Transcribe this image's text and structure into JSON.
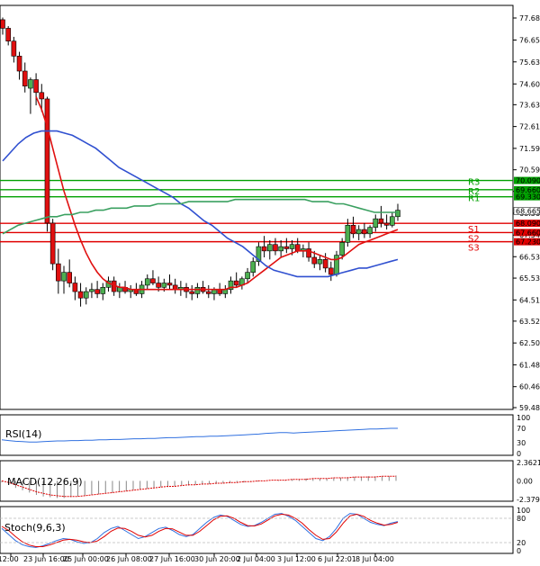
{
  "chart_data": [
    {
      "type": "candlestick",
      "price_axis": {
        "ticks": [
          "77.680",
          "76.650",
          "75.630",
          "74.600",
          "73.630",
          "72.610",
          "71.590",
          "70.590",
          "69.580",
          "68.560",
          "67.540",
          "66.530",
          "65.530",
          "64.510",
          "63.520",
          "62.500",
          "61.480",
          "60.460",
          "59.480"
        ],
        "tick_values": [
          77.68,
          76.65,
          75.63,
          74.6,
          73.63,
          72.61,
          71.59,
          70.59,
          69.58,
          68.56,
          67.54,
          66.53,
          65.53,
          64.51,
          63.52,
          62.5,
          61.48,
          60.46,
          59.48
        ],
        "ylim": [
          59.48,
          77.68
        ]
      },
      "time_axis": {
        "ticks": [
          "n 12:00",
          "23 Jun 16:00",
          "25 Jun 00:00",
          "26 Jun 08:00",
          "27 Jun 16:00",
          "30 Jun 20:00",
          "2 Jul 04:00",
          "3 Jul 12:00",
          "6 Jul 22:01",
          "8 Jul 04:00"
        ]
      },
      "current_price": "68.665",
      "levels": [
        {
          "label": "R3",
          "value": "70.090",
          "color": "#00a000"
        },
        {
          "label": "R2",
          "value": "69.660",
          "color": "#00a000"
        },
        {
          "label": "R1",
          "value": "69.330",
          "color": "#00a000"
        },
        {
          "label": "S1",
          "value": "68.090",
          "color": "#e00000"
        },
        {
          "label": "S2",
          "value": "67.660",
          "color": "#e00000"
        },
        {
          "label": "S3",
          "value": "67.230",
          "color": "#e00000"
        }
      ],
      "candles": [
        {
          "o": 77.6,
          "h": 77.7,
          "l": 76.9,
          "c": 77.2
        },
        {
          "o": 77.2,
          "h": 77.3,
          "l": 76.4,
          "c": 76.6
        },
        {
          "o": 76.6,
          "h": 76.8,
          "l": 75.6,
          "c": 75.9
        },
        {
          "o": 75.9,
          "h": 76.1,
          "l": 74.8,
          "c": 75.2
        },
        {
          "o": 75.2,
          "h": 75.6,
          "l": 74.2,
          "c": 74.5
        },
        {
          "o": 74.4,
          "h": 74.9,
          "l": 73.2,
          "c": 74.8
        },
        {
          "o": 74.8,
          "h": 75.1,
          "l": 73.6,
          "c": 74.2
        },
        {
          "o": 74.2,
          "h": 74.6,
          "l": 73.3,
          "c": 73.9
        },
        {
          "o": 73.9,
          "h": 74.0,
          "l": 67.7,
          "c": 68.1
        },
        {
          "o": 68.1,
          "h": 68.3,
          "l": 65.9,
          "c": 66.2
        },
        {
          "o": 66.2,
          "h": 66.9,
          "l": 64.8,
          "c": 65.4
        },
        {
          "o": 65.4,
          "h": 66.1,
          "l": 64.8,
          "c": 65.8
        },
        {
          "o": 65.8,
          "h": 66.4,
          "l": 65.1,
          "c": 65.3
        },
        {
          "o": 65.3,
          "h": 65.6,
          "l": 64.5,
          "c": 64.9
        },
        {
          "o": 64.9,
          "h": 65.3,
          "l": 64.2,
          "c": 64.6
        },
        {
          "o": 64.6,
          "h": 65.1,
          "l": 64.3,
          "c": 64.9
        },
        {
          "o": 64.9,
          "h": 65.3,
          "l": 64.6,
          "c": 65.0
        },
        {
          "o": 65.0,
          "h": 65.4,
          "l": 64.6,
          "c": 64.8
        },
        {
          "o": 64.8,
          "h": 65.3,
          "l": 64.5,
          "c": 65.1
        },
        {
          "o": 65.1,
          "h": 65.6,
          "l": 64.9,
          "c": 65.4
        },
        {
          "o": 65.4,
          "h": 65.6,
          "l": 64.7,
          "c": 64.9
        },
        {
          "o": 64.9,
          "h": 65.3,
          "l": 64.6,
          "c": 65.1
        },
        {
          "o": 65.1,
          "h": 65.4,
          "l": 64.8,
          "c": 64.9
        },
        {
          "o": 64.9,
          "h": 65.2,
          "l": 64.6,
          "c": 65.0
        },
        {
          "o": 65.0,
          "h": 65.3,
          "l": 64.7,
          "c": 64.8
        },
        {
          "o": 64.8,
          "h": 65.4,
          "l": 64.6,
          "c": 65.2
        },
        {
          "o": 65.2,
          "h": 65.7,
          "l": 65.0,
          "c": 65.5
        },
        {
          "o": 65.5,
          "h": 65.9,
          "l": 65.2,
          "c": 65.3
        },
        {
          "o": 65.3,
          "h": 65.6,
          "l": 64.9,
          "c": 65.1
        },
        {
          "o": 65.1,
          "h": 65.5,
          "l": 64.9,
          "c": 65.3
        },
        {
          "o": 65.3,
          "h": 65.7,
          "l": 65.0,
          "c": 65.2
        },
        {
          "o": 65.2,
          "h": 65.5,
          "l": 64.8,
          "c": 65.0
        },
        {
          "o": 65.0,
          "h": 65.4,
          "l": 64.7,
          "c": 65.1
        },
        {
          "o": 65.1,
          "h": 65.3,
          "l": 64.6,
          "c": 64.9
        },
        {
          "o": 64.9,
          "h": 65.2,
          "l": 64.5,
          "c": 64.8
        },
        {
          "o": 64.8,
          "h": 65.3,
          "l": 64.6,
          "c": 65.1
        },
        {
          "o": 65.1,
          "h": 65.4,
          "l": 64.8,
          "c": 64.9
        },
        {
          "o": 64.9,
          "h": 65.2,
          "l": 64.6,
          "c": 64.8
        },
        {
          "o": 64.8,
          "h": 65.1,
          "l": 64.5,
          "c": 65.0
        },
        {
          "o": 65.0,
          "h": 65.3,
          "l": 64.7,
          "c": 64.8
        },
        {
          "o": 64.8,
          "h": 65.2,
          "l": 64.6,
          "c": 65.0
        },
        {
          "o": 65.0,
          "h": 65.6,
          "l": 64.8,
          "c": 65.4
        },
        {
          "o": 65.4,
          "h": 65.8,
          "l": 65.1,
          "c": 65.2
        },
        {
          "o": 65.2,
          "h": 65.6,
          "l": 65.0,
          "c": 65.5
        },
        {
          "o": 65.5,
          "h": 66.0,
          "l": 65.3,
          "c": 65.8
        },
        {
          "o": 65.8,
          "h": 66.5,
          "l": 65.6,
          "c": 66.3
        },
        {
          "o": 66.3,
          "h": 67.2,
          "l": 66.1,
          "c": 67.0
        },
        {
          "o": 67.0,
          "h": 67.5,
          "l": 66.5,
          "c": 66.8
        },
        {
          "o": 66.8,
          "h": 67.3,
          "l": 66.4,
          "c": 67.1
        },
        {
          "o": 67.1,
          "h": 67.4,
          "l": 66.6,
          "c": 66.8
        },
        {
          "o": 66.8,
          "h": 67.3,
          "l": 66.5,
          "c": 67.0
        },
        {
          "o": 67.0,
          "h": 67.4,
          "l": 66.7,
          "c": 66.9
        },
        {
          "o": 66.9,
          "h": 67.3,
          "l": 66.6,
          "c": 67.1
        },
        {
          "o": 67.1,
          "h": 67.4,
          "l": 66.7,
          "c": 66.8
        },
        {
          "o": 66.8,
          "h": 67.1,
          "l": 66.5,
          "c": 66.9
        },
        {
          "o": 66.9,
          "h": 67.2,
          "l": 66.3,
          "c": 66.5
        },
        {
          "o": 66.5,
          "h": 66.8,
          "l": 66.0,
          "c": 66.2
        },
        {
          "o": 66.2,
          "h": 66.6,
          "l": 65.9,
          "c": 66.4
        },
        {
          "o": 66.4,
          "h": 66.7,
          "l": 65.8,
          "c": 66.0
        },
        {
          "o": 66.0,
          "h": 66.3,
          "l": 65.4,
          "c": 65.7
        },
        {
          "o": 65.7,
          "h": 66.8,
          "l": 65.6,
          "c": 66.6
        },
        {
          "o": 66.6,
          "h": 67.4,
          "l": 66.4,
          "c": 67.2
        },
        {
          "o": 67.2,
          "h": 68.3,
          "l": 67.0,
          "c": 68.0
        },
        {
          "o": 68.0,
          "h": 68.4,
          "l": 67.4,
          "c": 67.6
        },
        {
          "o": 67.6,
          "h": 68.0,
          "l": 67.3,
          "c": 67.8
        },
        {
          "o": 67.8,
          "h": 68.1,
          "l": 67.4,
          "c": 67.6
        },
        {
          "o": 67.6,
          "h": 68.0,
          "l": 67.4,
          "c": 67.9
        },
        {
          "o": 67.9,
          "h": 68.5,
          "l": 67.7,
          "c": 68.3
        },
        {
          "o": 68.3,
          "h": 68.9,
          "l": 67.9,
          "c": 68.1
        },
        {
          "o": 68.1,
          "h": 68.5,
          "l": 67.8,
          "c": 68.0
        },
        {
          "o": 68.0,
          "h": 68.6,
          "l": 67.9,
          "c": 68.4
        },
        {
          "o": 68.4,
          "h": 69.0,
          "l": 68.2,
          "c": 68.7
        }
      ],
      "series": [
        {
          "color": "#e01010",
          "values": [
            null,
            null,
            null,
            null,
            null,
            null,
            74.0,
            73.4,
            72.6,
            71.6,
            70.6,
            69.6,
            68.8,
            68.0,
            67.3,
            66.7,
            66.2,
            65.8,
            65.5,
            65.3,
            65.2,
            65.1,
            65.1,
            65.0,
            65.0,
            65.0,
            65.0,
            65.0,
            65.0,
            65.0,
            65.0,
            65.0,
            65.0,
            65.0,
            65.0,
            65.0,
            65.0,
            65.0,
            65.0,
            65.0,
            65.0,
            65.1,
            65.1,
            65.2,
            65.3,
            65.5,
            65.7,
            65.9,
            66.1,
            66.3,
            66.5,
            66.6,
            66.7,
            66.8,
            66.8,
            66.8,
            66.7,
            66.6,
            66.5,
            66.4,
            66.4,
            66.5,
            66.7,
            66.9,
            67.1,
            67.2,
            67.3,
            67.4,
            67.5,
            67.6,
            67.7,
            67.8
          ]
        },
        {
          "color": "#3050d0",
          "values": [
            71.0,
            71.4,
            71.8,
            72.1,
            72.3,
            72.4,
            72.4,
            72.4,
            72.3,
            72.2,
            72.0,
            71.8,
            71.6,
            71.3,
            71.0,
            70.7,
            70.5,
            70.3,
            70.1,
            69.9,
            69.7,
            69.5,
            69.3,
            69.0,
            68.8,
            68.5,
            68.2,
            68.0,
            67.7,
            67.4,
            67.2,
            67.0,
            66.7,
            66.4,
            66.1,
            65.9,
            65.8,
            65.7,
            65.6,
            65.6,
            65.6,
            65.6,
            65.6,
            65.7,
            65.8,
            65.9,
            66.0,
            66.0,
            66.1,
            66.2,
            66.3,
            66.4
          ]
        },
        {
          "color": "#3aa060",
          "values": [
            67.6,
            67.8,
            68.0,
            68.1,
            68.2,
            68.3,
            68.4,
            68.4,
            68.5,
            68.5,
            68.6,
            68.6,
            68.7,
            68.7,
            68.8,
            68.8,
            68.8,
            68.9,
            68.9,
            68.9,
            69.0,
            69.0,
            69.0,
            69.0,
            69.1,
            69.1,
            69.1,
            69.1,
            69.1,
            69.1,
            69.2,
            69.2,
            69.2,
            69.2,
            69.2,
            69.2,
            69.2,
            69.2,
            69.2,
            69.2,
            69.1,
            69.1,
            69.1,
            69.0,
            69.0,
            68.9,
            68.8,
            68.7,
            68.6,
            68.6,
            68.6,
            68.6
          ]
        }
      ]
    },
    {
      "type": "line",
      "title": "RSI(14)",
      "y_ticks": [
        "100",
        "70",
        "30",
        "0"
      ],
      "ylim": [
        0,
        100
      ],
      "series": [
        {
          "color": "#3070e0",
          "values": [
            38,
            36,
            34,
            33,
            32,
            32,
            33,
            34,
            35,
            35,
            36,
            36,
            37,
            37,
            38,
            38,
            39,
            39,
            40,
            41,
            41,
            42,
            42,
            43,
            44,
            44,
            45,
            46,
            47,
            47,
            48,
            48,
            49,
            50,
            51,
            52,
            53,
            54,
            56,
            57,
            58,
            58,
            57,
            58,
            59,
            60,
            61,
            62,
            63,
            64,
            65,
            66,
            67,
            68,
            68,
            69,
            70,
            70
          ]
        }
      ]
    },
    {
      "type": "bar",
      "title": "MACD(12,26,9)",
      "y_ticks": [
        "2.3621",
        "0.00",
        "-2.3797"
      ],
      "ylim": [
        -2.3797,
        2.3621
      ],
      "values": [
        -0.2,
        -0.5,
        -0.9,
        -1.2,
        -1.5,
        -1.8,
        -2.0,
        -2.1,
        -2.2,
        -2.2,
        -2.1,
        -2.0,
        -1.9,
        -1.8,
        -1.7,
        -1.6,
        -1.5,
        -1.4,
        -1.3,
        -1.2,
        -1.1,
        -1.0,
        -0.9,
        -0.8,
        -0.8,
        -0.7,
        -0.6,
        -0.6,
        -0.5,
        -0.5,
        -0.4,
        -0.4,
        -0.3,
        -0.3,
        -0.2,
        -0.2,
        -0.1,
        -0.1,
        0.0,
        0.0,
        0.1,
        0.1,
        0.2,
        0.2,
        0.3,
        0.3,
        0.3,
        0.3,
        0.4,
        0.4,
        0.5,
        0.5,
        0.5,
        0.6,
        0.6,
        0.6,
        0.6,
        0.7
      ],
      "signal": {
        "color": "#e00000",
        "values": [
          0.0,
          -0.2,
          -0.5,
          -0.8,
          -1.1,
          -1.4,
          -1.6,
          -1.8,
          -1.9,
          -2.0,
          -2.0,
          -2.0,
          -1.9,
          -1.8,
          -1.7,
          -1.6,
          -1.5,
          -1.4,
          -1.3,
          -1.2,
          -1.1,
          -1.0,
          -0.9,
          -0.8,
          -0.7,
          -0.7,
          -0.6,
          -0.5,
          -0.5,
          -0.4,
          -0.4,
          -0.3,
          -0.3,
          -0.2,
          -0.2,
          -0.1,
          -0.1,
          0.0,
          0.0,
          0.1,
          0.1,
          0.1,
          0.2,
          0.2,
          0.2,
          0.3,
          0.3,
          0.3,
          0.4,
          0.4,
          0.4,
          0.5,
          0.5,
          0.5,
          0.5,
          0.6,
          0.6,
          0.6
        ]
      }
    },
    {
      "type": "line",
      "title": "Stoch(9,6,3)",
      "y_ticks": [
        "100",
        "80",
        "20",
        "0"
      ],
      "ylim": [
        0,
        100
      ],
      "series": [
        {
          "color": "#3070e0",
          "values": [
            55,
            40,
            25,
            15,
            10,
            8,
            12,
            18,
            25,
            30,
            28,
            22,
            18,
            20,
            30,
            45,
            55,
            60,
            50,
            40,
            30,
            35,
            45,
            55,
            58,
            50,
            40,
            35,
            40,
            55,
            70,
            82,
            88,
            85,
            75,
            65,
            60,
            62,
            70,
            80,
            90,
            92,
            85,
            75,
            60,
            45,
            30,
            25,
            35,
            55,
            80,
            92,
            90,
            80,
            70,
            65,
            62,
            68,
            72
          ]
        },
        {
          "color": "#e00000",
          "values": [
            60,
            50,
            35,
            22,
            14,
            10,
            10,
            14,
            20,
            26,
            28,
            26,
            22,
            20,
            24,
            35,
            48,
            56,
            55,
            48,
            38,
            34,
            38,
            48,
            55,
            54,
            46,
            38,
            38,
            48,
            62,
            76,
            85,
            86,
            80,
            70,
            62,
            61,
            66,
            76,
            86,
            90,
            88,
            80,
            68,
            52,
            38,
            28,
            30,
            46,
            68,
            86,
            90,
            85,
            75,
            68,
            63,
            65,
            70
          ]
        }
      ]
    }
  ]
}
